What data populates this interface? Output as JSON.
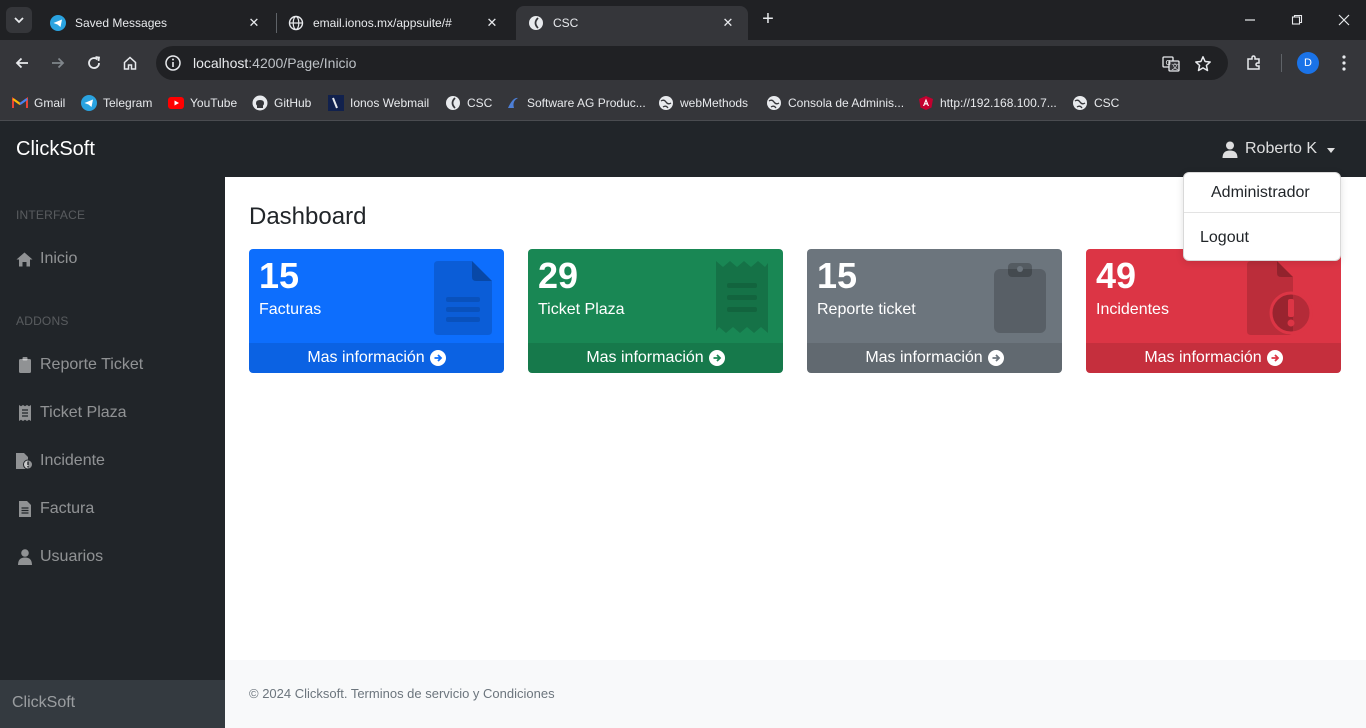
{
  "browser": {
    "tabs": [
      {
        "title": "Saved Messages",
        "icon": "telegram-icon",
        "active": false
      },
      {
        "title": "email.ionos.mx/appsuite/#",
        "icon": "globe-icon",
        "active": false
      },
      {
        "title": "CSC",
        "icon": "csc-icon",
        "active": true
      }
    ],
    "url_host": "localhost",
    "url_rest": ":4200/Page/Inicio",
    "profile_initial": "D",
    "bookmarks": [
      {
        "label": "Gmail",
        "icon": "gmail-icon"
      },
      {
        "label": "Telegram",
        "icon": "telegram-icon"
      },
      {
        "label": "YouTube",
        "icon": "youtube-icon"
      },
      {
        "label": "GitHub",
        "icon": "github-icon"
      },
      {
        "label": "Ionos Webmail",
        "icon": "ionos-icon"
      },
      {
        "label": "CSC",
        "icon": "csc-icon"
      },
      {
        "label": "Software AG Produc...",
        "icon": "softwareag-icon"
      },
      {
        "label": "webMethods",
        "icon": "globe-icon"
      },
      {
        "label": "Consola de Adminis...",
        "icon": "globe-icon"
      },
      {
        "label": "http://192.168.100.7...",
        "icon": "angular-icon"
      },
      {
        "label": "CSC",
        "icon": "globe-icon"
      }
    ]
  },
  "app": {
    "brand": "ClickSoft",
    "user_name": "Roberto K",
    "user_menu": {
      "role": "Administrador",
      "logout": "Logout"
    },
    "sidebar": {
      "heading_interface": "INTERFACE",
      "heading_addons": "ADDONS",
      "items": [
        {
          "label": "Inicio",
          "icon": "home-icon"
        },
        {
          "label": "Reporte Ticket",
          "icon": "clipboard-icon"
        },
        {
          "label": "Ticket Plaza",
          "icon": "receipt-icon"
        },
        {
          "label": "Incidente",
          "icon": "file-alert-icon"
        },
        {
          "label": "Factura",
          "icon": "document-icon"
        },
        {
          "label": "Usuarios",
          "icon": "user-icon"
        }
      ],
      "footer": "ClickSoft"
    },
    "page_title": "Dashboard",
    "cards": [
      {
        "count": "15",
        "label": "Facturas",
        "more": "Mas información",
        "color": "#0d6efd",
        "icon": "document-icon"
      },
      {
        "count": "29",
        "label": "Ticket Plaza",
        "more": "Mas información",
        "color": "#198754",
        "icon": "receipt-icon"
      },
      {
        "count": "15",
        "label": "Reporte ticket",
        "more": "Mas información",
        "color": "#6c757d",
        "icon": "clipboard-icon"
      },
      {
        "count": "49",
        "label": "Incidentes",
        "more": "Mas información",
        "color": "#dc3545",
        "icon": "file-alert-icon"
      }
    ],
    "footer_text": "© 2024 Clicksoft. Terminos de servicio y Condiciones"
  }
}
